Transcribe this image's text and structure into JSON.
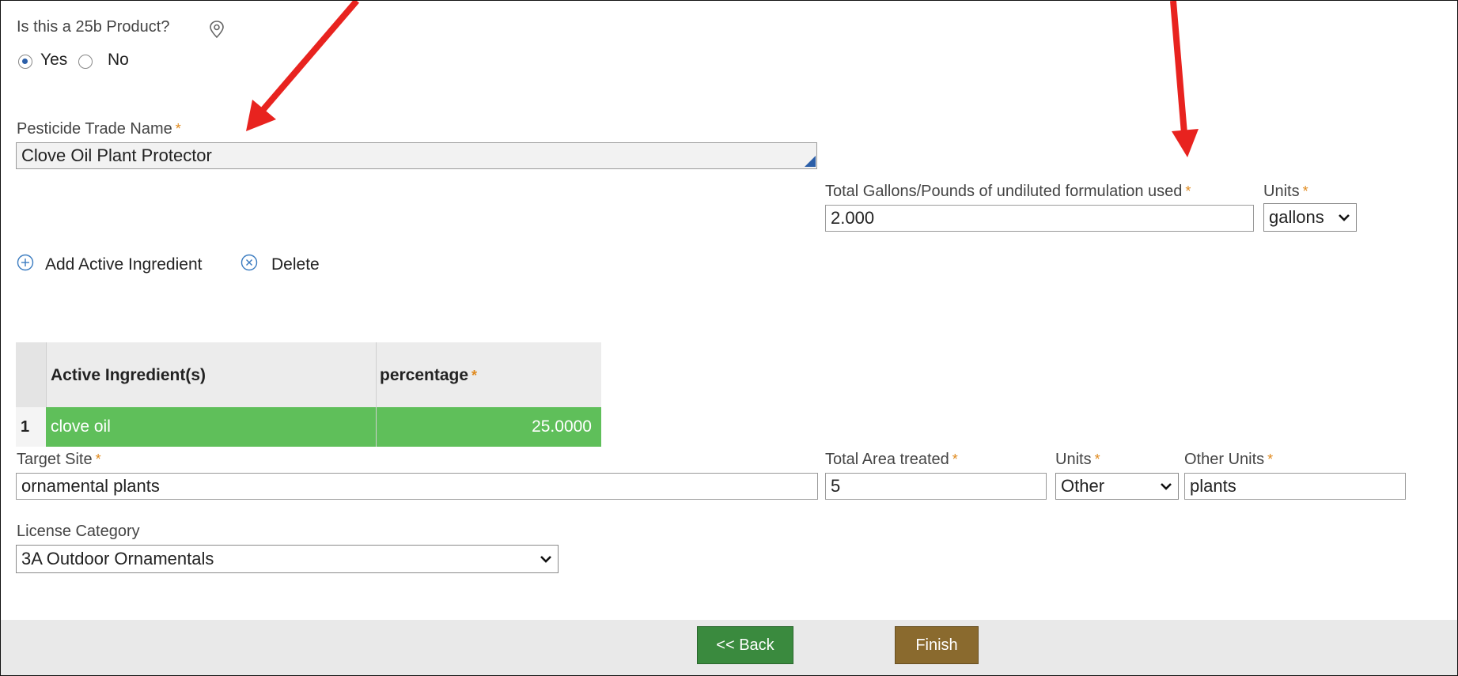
{
  "product_question": {
    "label": "Is this a 25b Product?",
    "icon": "location-pin-icon",
    "options": [
      {
        "label": "Yes",
        "selected": true
      },
      {
        "label": "No",
        "selected": false
      }
    ]
  },
  "trade_name": {
    "label": "Pesticide Trade Name",
    "required_mark": "*",
    "value": "Clove Oil Plant Protector"
  },
  "total_gallons": {
    "label": "Total Gallons/Pounds of undiluted formulation used",
    "required_mark": "*",
    "value": "2.000",
    "units_label": "Units",
    "units_value": "gallons"
  },
  "ingredient_actions": {
    "add_label": "Add Active Ingredient",
    "delete_label": "Delete"
  },
  "ingredients_table": {
    "headers": {
      "ingredient": "Active Ingredient(s)",
      "percentage": "percentage",
      "required_mark": "*"
    },
    "rows": [
      {
        "index": "1",
        "ingredient": "clove oil",
        "percentage": "25.0000"
      }
    ]
  },
  "target_site": {
    "label": "Target Site",
    "required_mark": "*",
    "value": "ornamental plants"
  },
  "area_treated": {
    "label": "Total Area treated",
    "required_mark": "*",
    "value": "5",
    "units_label": "Units",
    "units_value": "Other",
    "other_units_label": "Other Units",
    "other_units_value": "plants"
  },
  "license_category": {
    "label": "License Category",
    "value": "3A Outdoor Ornamentals"
  },
  "footer": {
    "back_label": "<< Back",
    "finish_label": "Finish"
  },
  "colors": {
    "required": "#e08a1e",
    "selected_row": "#5fbf5a",
    "back_button": "#3a8a3e",
    "finish_button": "#8a6a2e",
    "arrow": "#e8231f",
    "footer_bg": "#e9e9e9"
  }
}
